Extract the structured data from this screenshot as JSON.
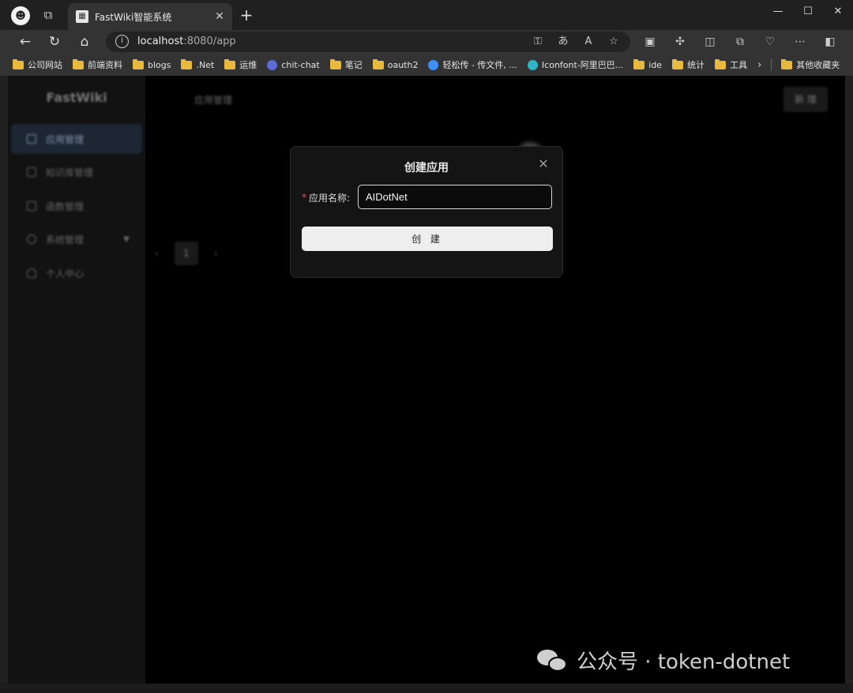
{
  "browser": {
    "tab_title": "FastWiki智能系统",
    "url_host": "localhost",
    "url_path": ":8080/app",
    "window_controls": {
      "minimize": "—",
      "maximize": "☐",
      "close": "✕"
    }
  },
  "bookmarks": [
    {
      "label": "公司网站",
      "kind": "folder"
    },
    {
      "label": "前端资料",
      "kind": "folder"
    },
    {
      "label": "blogs",
      "kind": "folder"
    },
    {
      "label": ".Net",
      "kind": "folder"
    },
    {
      "label": "运维",
      "kind": "folder"
    },
    {
      "label": "chit-chat",
      "kind": "site"
    },
    {
      "label": "笔记",
      "kind": "folder"
    },
    {
      "label": "oauth2",
      "kind": "folder"
    },
    {
      "label": "轻松传 - 传文件, ...",
      "kind": "site"
    },
    {
      "label": "Iconfont-阿里巴巴...",
      "kind": "site"
    },
    {
      "label": "ide",
      "kind": "folder"
    },
    {
      "label": "统计",
      "kind": "folder"
    },
    {
      "label": "工具",
      "kind": "folder"
    },
    {
      "label": "其他收藏夹",
      "kind": "folder"
    }
  ],
  "app": {
    "brand": "FastWiki",
    "breadcrumb": "应用管理",
    "new_button": "新 增",
    "menu": [
      {
        "label": "应用管理",
        "active": true
      },
      {
        "label": "知识库管理",
        "active": false
      },
      {
        "label": "函数管理",
        "active": false
      },
      {
        "label": "系统管理",
        "active": false
      },
      {
        "label": "个人中心",
        "active": false
      }
    ],
    "pagination": {
      "prev": "‹",
      "page": "1",
      "next": "›"
    }
  },
  "modal": {
    "title": "创建应用",
    "required_mark": "*",
    "field_label": "应用名称:",
    "field_value": "AIDotNet",
    "submit_label": "创 建"
  },
  "watermark": {
    "text": "公众号 · token-dotnet"
  },
  "colors": {
    "page_bg": "#000000",
    "modal_bg": "#141414",
    "required": "#e34d59",
    "button_bg": "#eeeeee"
  }
}
